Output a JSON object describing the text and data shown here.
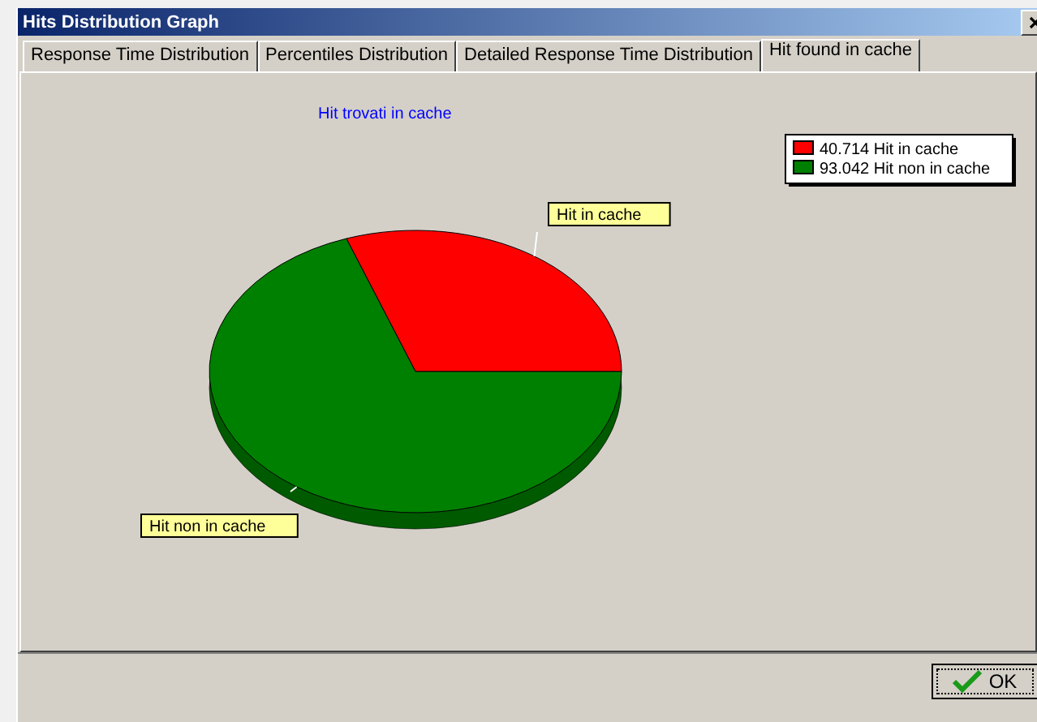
{
  "window": {
    "title": "Hits Distribution Graph"
  },
  "tabs": [
    {
      "label": "Response Time Distribution",
      "selected": false
    },
    {
      "label": "Percentiles Distribution",
      "selected": false
    },
    {
      "label": "Detailed Response Time Distribution",
      "selected": false
    },
    {
      "label": "Hit found in cache",
      "selected": true
    }
  ],
  "chart": {
    "legend": [
      {
        "label": "40.714 Hit in cache",
        "color": "#ff0000"
      },
      {
        "label": "93.042 Hit non in cache",
        "color": "#008000"
      }
    ],
    "chart_data": {
      "type": "pie",
      "title": "Hit trovati in cache",
      "categories": [
        "Hit in cache",
        "Hit non in cache"
      ],
      "values": [
        30.44,
        69.56
      ]
    }
  },
  "buttons": [
    {
      "label": "OK"
    }
  ]
}
